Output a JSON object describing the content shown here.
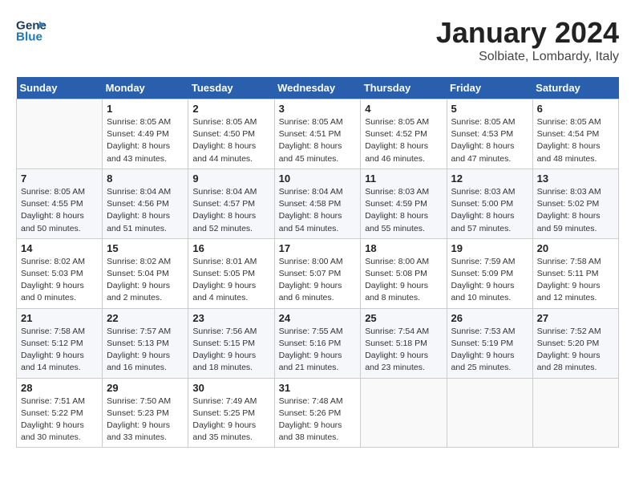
{
  "header": {
    "logo_line1": "General",
    "logo_line2": "Blue",
    "month": "January 2024",
    "location": "Solbiate, Lombardy, Italy"
  },
  "weekdays": [
    "Sunday",
    "Monday",
    "Tuesday",
    "Wednesday",
    "Thursday",
    "Friday",
    "Saturday"
  ],
  "weeks": [
    [
      {
        "day": "",
        "sunrise": "",
        "sunset": "",
        "daylight": ""
      },
      {
        "day": "1",
        "sunrise": "Sunrise: 8:05 AM",
        "sunset": "Sunset: 4:49 PM",
        "daylight": "Daylight: 8 hours and 43 minutes."
      },
      {
        "day": "2",
        "sunrise": "Sunrise: 8:05 AM",
        "sunset": "Sunset: 4:50 PM",
        "daylight": "Daylight: 8 hours and 44 minutes."
      },
      {
        "day": "3",
        "sunrise": "Sunrise: 8:05 AM",
        "sunset": "Sunset: 4:51 PM",
        "daylight": "Daylight: 8 hours and 45 minutes."
      },
      {
        "day": "4",
        "sunrise": "Sunrise: 8:05 AM",
        "sunset": "Sunset: 4:52 PM",
        "daylight": "Daylight: 8 hours and 46 minutes."
      },
      {
        "day": "5",
        "sunrise": "Sunrise: 8:05 AM",
        "sunset": "Sunset: 4:53 PM",
        "daylight": "Daylight: 8 hours and 47 minutes."
      },
      {
        "day": "6",
        "sunrise": "Sunrise: 8:05 AM",
        "sunset": "Sunset: 4:54 PM",
        "daylight": "Daylight: 8 hours and 48 minutes."
      }
    ],
    [
      {
        "day": "7",
        "sunrise": "Sunrise: 8:05 AM",
        "sunset": "Sunset: 4:55 PM",
        "daylight": "Daylight: 8 hours and 50 minutes."
      },
      {
        "day": "8",
        "sunrise": "Sunrise: 8:04 AM",
        "sunset": "Sunset: 4:56 PM",
        "daylight": "Daylight: 8 hours and 51 minutes."
      },
      {
        "day": "9",
        "sunrise": "Sunrise: 8:04 AM",
        "sunset": "Sunset: 4:57 PM",
        "daylight": "Daylight: 8 hours and 52 minutes."
      },
      {
        "day": "10",
        "sunrise": "Sunrise: 8:04 AM",
        "sunset": "Sunset: 4:58 PM",
        "daylight": "Daylight: 8 hours and 54 minutes."
      },
      {
        "day": "11",
        "sunrise": "Sunrise: 8:03 AM",
        "sunset": "Sunset: 4:59 PM",
        "daylight": "Daylight: 8 hours and 55 minutes."
      },
      {
        "day": "12",
        "sunrise": "Sunrise: 8:03 AM",
        "sunset": "Sunset: 5:00 PM",
        "daylight": "Daylight: 8 hours and 57 minutes."
      },
      {
        "day": "13",
        "sunrise": "Sunrise: 8:03 AM",
        "sunset": "Sunset: 5:02 PM",
        "daylight": "Daylight: 8 hours and 59 minutes."
      }
    ],
    [
      {
        "day": "14",
        "sunrise": "Sunrise: 8:02 AM",
        "sunset": "Sunset: 5:03 PM",
        "daylight": "Daylight: 9 hours and 0 minutes."
      },
      {
        "day": "15",
        "sunrise": "Sunrise: 8:02 AM",
        "sunset": "Sunset: 5:04 PM",
        "daylight": "Daylight: 9 hours and 2 minutes."
      },
      {
        "day": "16",
        "sunrise": "Sunrise: 8:01 AM",
        "sunset": "Sunset: 5:05 PM",
        "daylight": "Daylight: 9 hours and 4 minutes."
      },
      {
        "day": "17",
        "sunrise": "Sunrise: 8:00 AM",
        "sunset": "Sunset: 5:07 PM",
        "daylight": "Daylight: 9 hours and 6 minutes."
      },
      {
        "day": "18",
        "sunrise": "Sunrise: 8:00 AM",
        "sunset": "Sunset: 5:08 PM",
        "daylight": "Daylight: 9 hours and 8 minutes."
      },
      {
        "day": "19",
        "sunrise": "Sunrise: 7:59 AM",
        "sunset": "Sunset: 5:09 PM",
        "daylight": "Daylight: 9 hours and 10 minutes."
      },
      {
        "day": "20",
        "sunrise": "Sunrise: 7:58 AM",
        "sunset": "Sunset: 5:11 PM",
        "daylight": "Daylight: 9 hours and 12 minutes."
      }
    ],
    [
      {
        "day": "21",
        "sunrise": "Sunrise: 7:58 AM",
        "sunset": "Sunset: 5:12 PM",
        "daylight": "Daylight: 9 hours and 14 minutes."
      },
      {
        "day": "22",
        "sunrise": "Sunrise: 7:57 AM",
        "sunset": "Sunset: 5:13 PM",
        "daylight": "Daylight: 9 hours and 16 minutes."
      },
      {
        "day": "23",
        "sunrise": "Sunrise: 7:56 AM",
        "sunset": "Sunset: 5:15 PM",
        "daylight": "Daylight: 9 hours and 18 minutes."
      },
      {
        "day": "24",
        "sunrise": "Sunrise: 7:55 AM",
        "sunset": "Sunset: 5:16 PM",
        "daylight": "Daylight: 9 hours and 21 minutes."
      },
      {
        "day": "25",
        "sunrise": "Sunrise: 7:54 AM",
        "sunset": "Sunset: 5:18 PM",
        "daylight": "Daylight: 9 hours and 23 minutes."
      },
      {
        "day": "26",
        "sunrise": "Sunrise: 7:53 AM",
        "sunset": "Sunset: 5:19 PM",
        "daylight": "Daylight: 9 hours and 25 minutes."
      },
      {
        "day": "27",
        "sunrise": "Sunrise: 7:52 AM",
        "sunset": "Sunset: 5:20 PM",
        "daylight": "Daylight: 9 hours and 28 minutes."
      }
    ],
    [
      {
        "day": "28",
        "sunrise": "Sunrise: 7:51 AM",
        "sunset": "Sunset: 5:22 PM",
        "daylight": "Daylight: 9 hours and 30 minutes."
      },
      {
        "day": "29",
        "sunrise": "Sunrise: 7:50 AM",
        "sunset": "Sunset: 5:23 PM",
        "daylight": "Daylight: 9 hours and 33 minutes."
      },
      {
        "day": "30",
        "sunrise": "Sunrise: 7:49 AM",
        "sunset": "Sunset: 5:25 PM",
        "daylight": "Daylight: 9 hours and 35 minutes."
      },
      {
        "day": "31",
        "sunrise": "Sunrise: 7:48 AM",
        "sunset": "Sunset: 5:26 PM",
        "daylight": "Daylight: 9 hours and 38 minutes."
      },
      {
        "day": "",
        "sunrise": "",
        "sunset": "",
        "daylight": ""
      },
      {
        "day": "",
        "sunrise": "",
        "sunset": "",
        "daylight": ""
      },
      {
        "day": "",
        "sunrise": "",
        "sunset": "",
        "daylight": ""
      }
    ]
  ]
}
